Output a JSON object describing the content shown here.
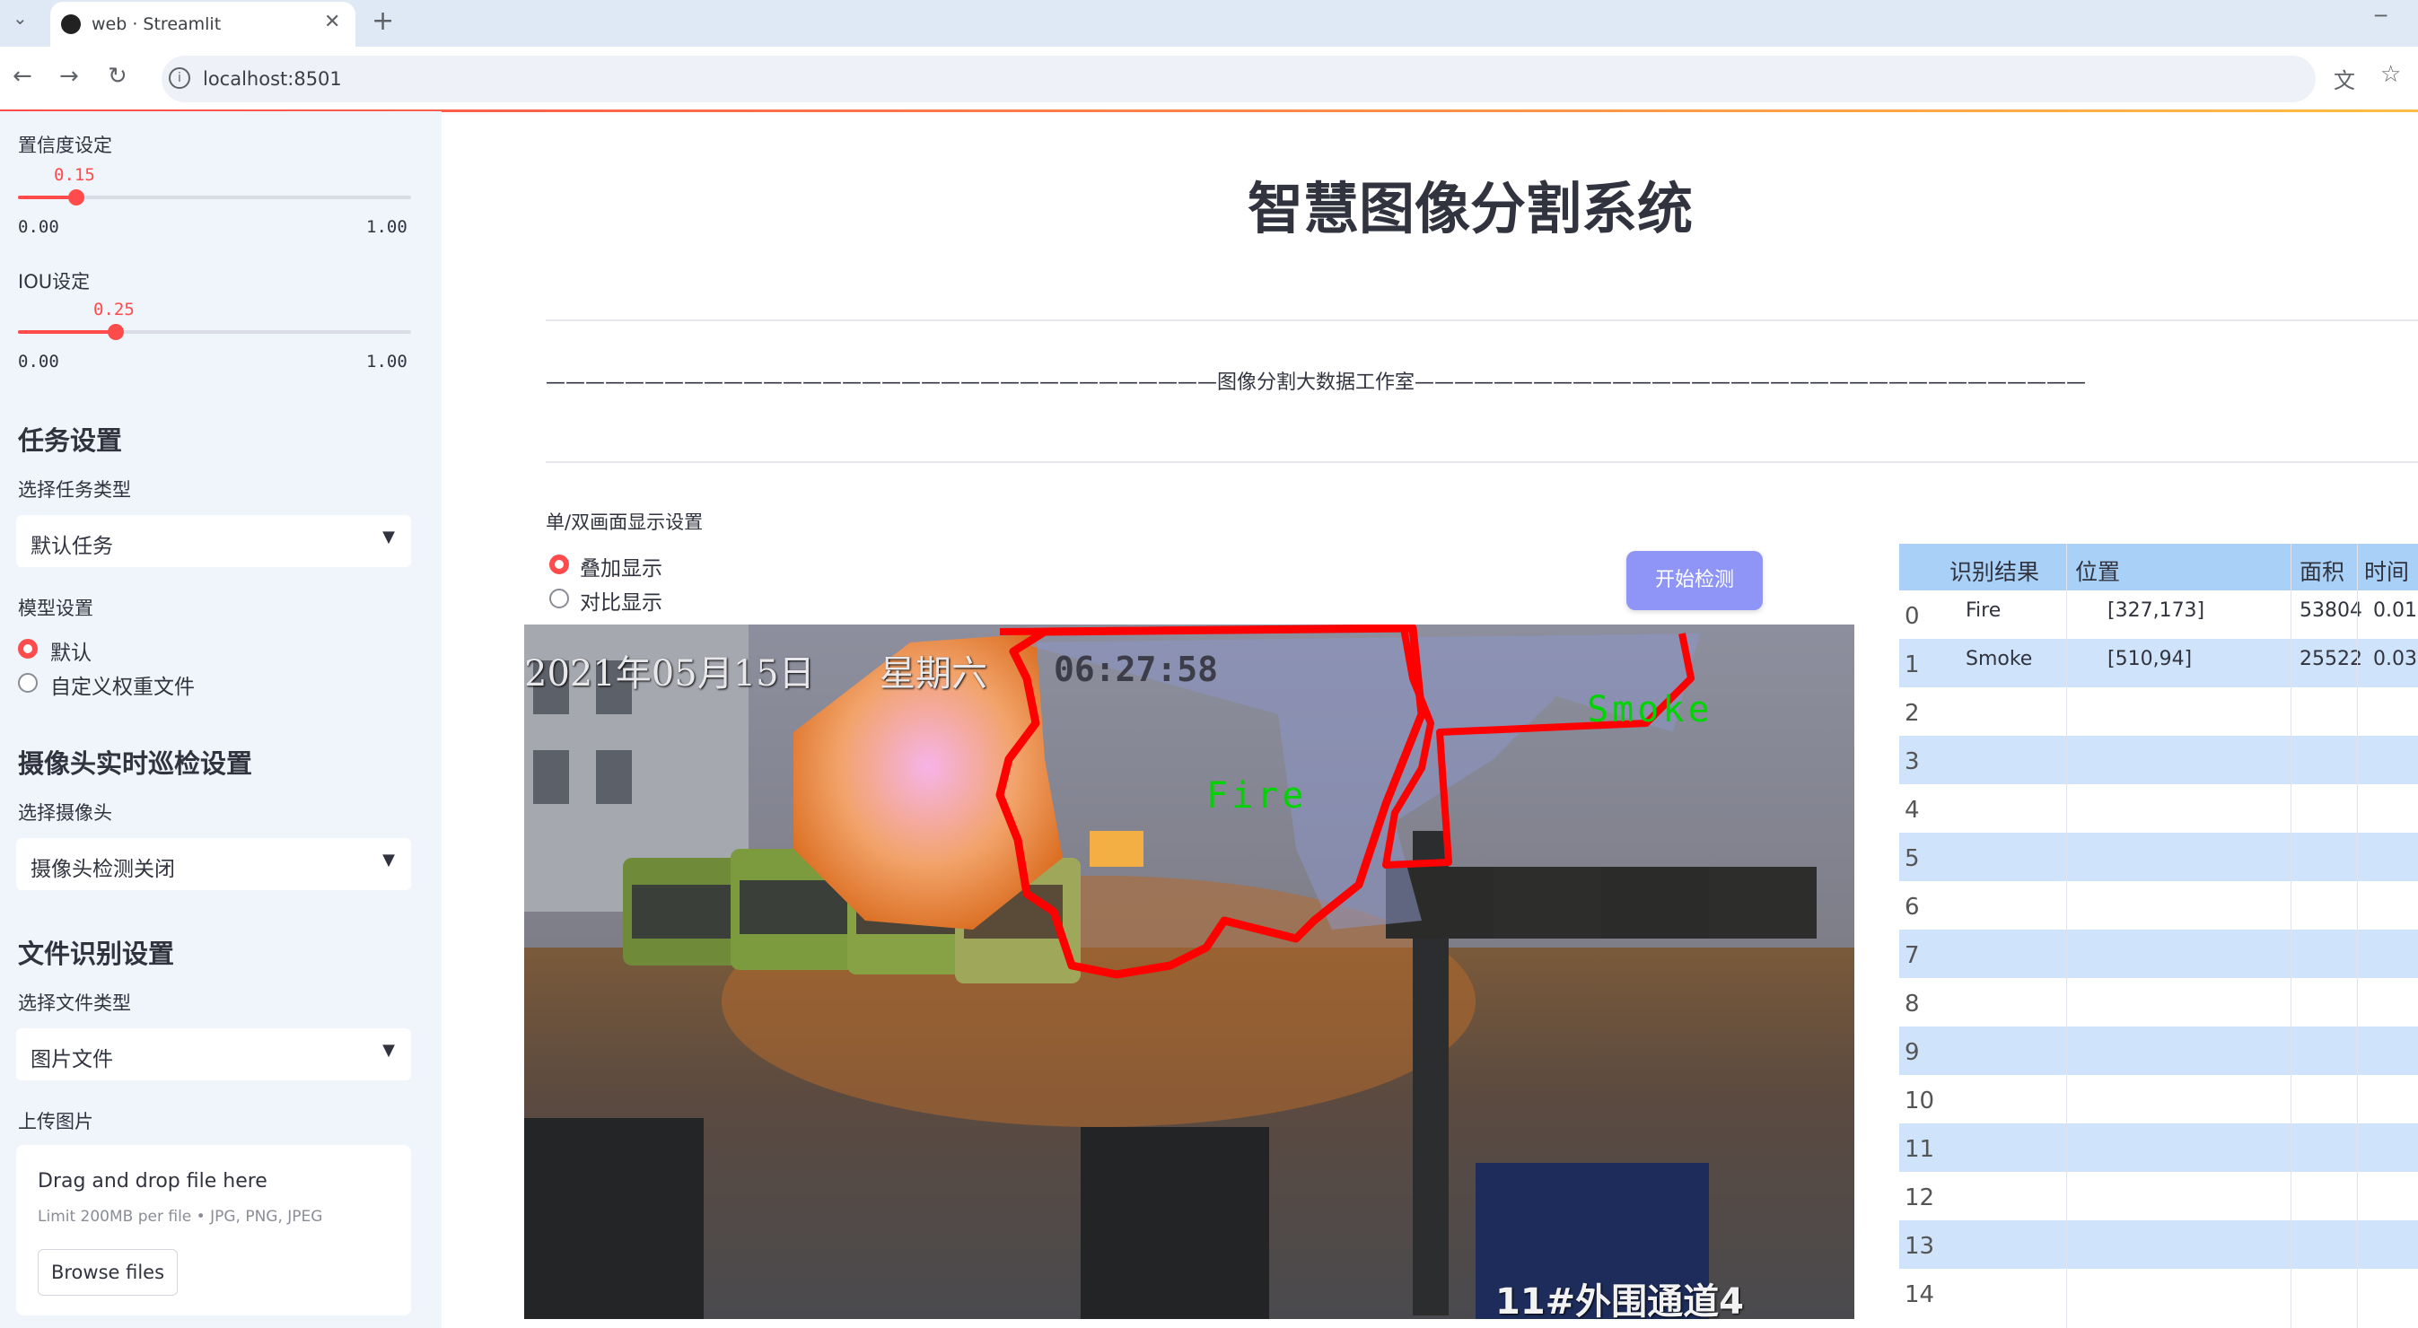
{
  "browser": {
    "tab_title": "web · Streamlit",
    "url": "localhost:8501",
    "new_tab": "+",
    "minimize": "─"
  },
  "sidebar": {
    "confidence": {
      "label": "置信度设定",
      "value": "0.15",
      "min": "0.00",
      "max": "1.00",
      "fraction": 0.15
    },
    "iou": {
      "label": "IOU设定",
      "value": "0.25",
      "min": "0.00",
      "max": "1.00",
      "fraction": 0.25
    },
    "task_header": "任务设置",
    "task_label": "选择任务类型",
    "task_value": "默认任务",
    "model_label": "模型设置",
    "model_options": [
      "默认",
      "自定义权重文件"
    ],
    "model_selected": 0,
    "camera_header": "摄像头实时巡检设置",
    "camera_label": "选择摄像头",
    "camera_value": "摄像头检测关闭",
    "file_header": "文件识别设置",
    "file_type_label": "选择文件类型",
    "file_type_value": "图片文件",
    "upload_label": "上传图片",
    "upload_drag": "Drag and drop file here",
    "upload_limit": "Limit 200MB per file • JPG, PNG, JPEG",
    "browse": "Browse files"
  },
  "main": {
    "title": "智慧图像分割系统",
    "divider_text": "——————————————————————————————————图像分割大数据工作室——————————————————————————————————",
    "display_label": "单/双画面显示设置",
    "display_options": [
      "叠加显示",
      "对比显示"
    ],
    "display_selected": 0,
    "start_button": "开始检测",
    "image": {
      "timestamp_date": "2021年05月15日",
      "timestamp_day": "星期六",
      "timestamp_time": "06:27:58",
      "camera_name": "11#外围通道4",
      "labels": [
        "Fire",
        "Smoke"
      ]
    }
  },
  "table": {
    "headers": [
      "识别结果",
      "位置",
      "面积",
      "时间"
    ],
    "rows": [
      {
        "index": "0",
        "result": "Fire",
        "position": "[327,173]",
        "area": "53804",
        "time": "0.01"
      },
      {
        "index": "1",
        "result": "Smoke",
        "position": "[510,94]",
        "area": "25522",
        "time": "0.03"
      },
      {
        "index": "2"
      },
      {
        "index": "3"
      },
      {
        "index": "4"
      },
      {
        "index": "5"
      },
      {
        "index": "6"
      },
      {
        "index": "7"
      },
      {
        "index": "8"
      },
      {
        "index": "9"
      },
      {
        "index": "10"
      },
      {
        "index": "11"
      },
      {
        "index": "12"
      },
      {
        "index": "13"
      },
      {
        "index": "14"
      }
    ]
  },
  "colors": {
    "accent": "#ff4b4b",
    "button": "#8f95f6",
    "table_stripe": "#cfe3fb",
    "table_header": "#a9d0f7"
  }
}
